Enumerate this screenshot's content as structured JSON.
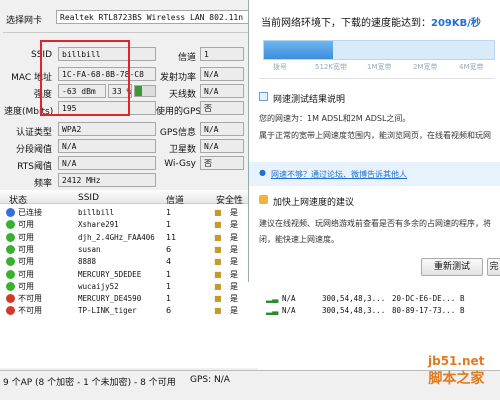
{
  "left_panel": {
    "adapter_label": "选择网卡",
    "adapter_value": "Realtek RTL8723BS Wireless LAN 802.11n SDIO",
    "ssid_label": "SSID",
    "ssid_value": "billbill",
    "mac_label": "MAC 地址",
    "mac_value": "1C-FA-68-8B-78-C8",
    "strength_label": "强度",
    "strength_dbm": "-63 dBm",
    "strength_pct": "33 %",
    "speed_label": "速度(Mbits)",
    "speed_value": "195",
    "auth_label": "认证类型",
    "auth_value": "WPA2",
    "frag_label": "分段阈值",
    "frag_value": "N/A",
    "rts_label": "RTS阈值",
    "rts_value": "N/A",
    "freq_label": "频率",
    "freq_value": "2412 MHz",
    "channel_label": "信道",
    "channel_value": "1",
    "txpower_label": "发射功率",
    "txpower_value": "N/A",
    "antenna_label": "天线数",
    "antenna_value": "N/A",
    "gps_used_label": "使用的GPS",
    "gps_used_value": "否",
    "gps_info_label": "GPS信息",
    "gps_info_value": "N/A",
    "satellite_label": "卫星数",
    "satellite_value": "N/A",
    "wigsy_label": "Wi-Gsy",
    "wigsy_value": "否"
  },
  "network_panel": {
    "title": "当前网络环境下，下载的速度能达到：",
    "speed": "209KB/秒",
    "scale": [
      "拨号",
      "512K宽带",
      "1M宽带",
      "2M宽带",
      "4M宽带"
    ],
    "section1_title": "网速测试结果说明",
    "section1_line1": "您的网速为：1M ADSL和2M ADSL之间。",
    "section1_line2": "属于正常的宽带上网速度范围内，能浏览网页，在线看视频和玩网",
    "question_link": "网速不够？通过论坛、微博告诉其他人",
    "section2_title": "加快上网速度的建议",
    "section2_line1": "建议在线视频、玩网络游戏前查看是否有多余的占网速的程序，将",
    "section2_line2": "闭，能快速上网速度。",
    "retest_button": "重新测试",
    "done_button": "完"
  },
  "table": {
    "headers": [
      "状态",
      "SSID",
      "信道",
      "安全性"
    ],
    "rows": [
      {
        "status": "已连接",
        "ssid": "billbill",
        "channel": "1",
        "sec": "是",
        "color": "#3a6fd8"
      },
      {
        "status": "可用",
        "ssid": "Xshare291",
        "channel": "1",
        "sec": "是",
        "color": "#39b030"
      },
      {
        "status": "可用",
        "ssid": "djh_2.4GHz_FAA406",
        "channel": "11",
        "sec": "是",
        "color": "#39b030"
      },
      {
        "status": "可用",
        "ssid": "susan",
        "channel": "6",
        "sec": "是",
        "color": "#39b030"
      },
      {
        "status": "可用",
        "ssid": "8888",
        "channel": "4",
        "sec": "是",
        "color": "#39b030"
      },
      {
        "status": "可用",
        "ssid": "MERCURY_5DEDEE",
        "channel": "1",
        "sec": "是",
        "color": "#39b030"
      },
      {
        "status": "可用",
        "ssid": "wucaijy52",
        "channel": "1",
        "sec": "是",
        "color": "#39b030"
      },
      {
        "status": "不可用",
        "ssid": "MERCURY_DE4590",
        "channel": "1",
        "sec": "是",
        "color": "#d23a2a",
        "extra": [
          "N/A",
          "300,54,48,3...",
          "20-DC-E6-DE...",
          "B"
        ]
      },
      {
        "status": "不可用",
        "ssid": "TP-LINK_tiger",
        "channel": "6",
        "sec": "是",
        "color": "#d23a2a",
        "extra": [
          "N/A",
          "300,54,48,3...",
          "80-89-17-73...",
          "B"
        ]
      }
    ]
  },
  "status_bar": {
    "text": "9 个AP (8 个加密 - 1 个未加密) - 8 个可用",
    "gps": "GPS: N/A"
  },
  "watermark": {
    "line1": "jb51.net",
    "line2": "脚本之家"
  }
}
